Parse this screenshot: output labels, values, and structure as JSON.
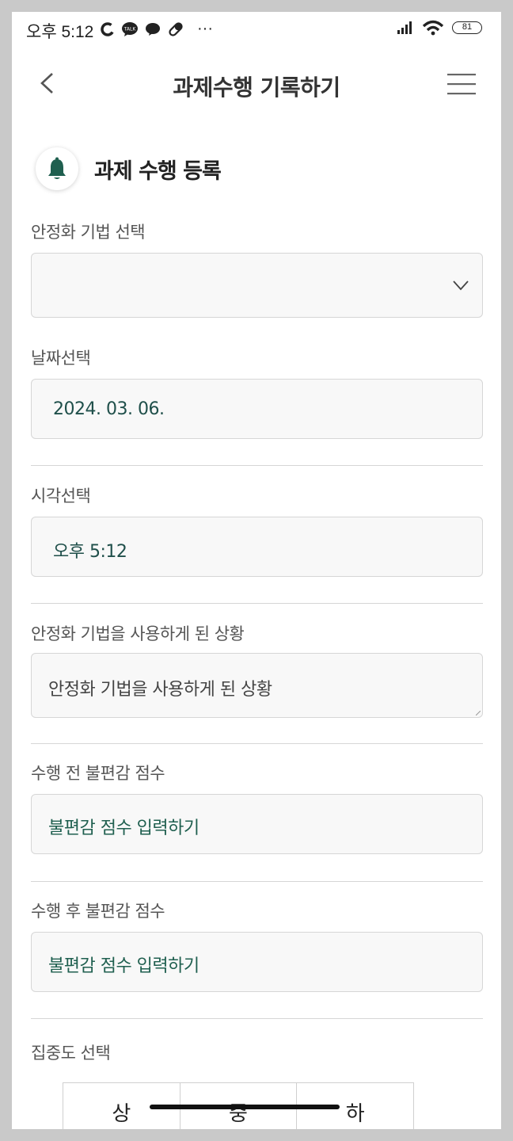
{
  "status_bar": {
    "time": "오후 5:12",
    "battery": "81",
    "more": "···"
  },
  "header": {
    "title": "과제수행 기록하기"
  },
  "section": {
    "title": "과제 수행 등록"
  },
  "form": {
    "technique_label": "안정화 기법 선택",
    "technique_value": "",
    "date_label": "날짜선택",
    "date_value": "2024. 03. 06.",
    "time_label": "시각선택",
    "time_value": "오후 5:12",
    "situation_label": "안정화 기법을 사용하게 된 상황",
    "situation_placeholder": "안정화 기법을 사용하게 된 상황",
    "before_label": "수행 전 불편감 점수",
    "before_placeholder": "불편감 점수 입력하기",
    "after_label": "수행 후 불편감 점수",
    "after_placeholder": "불편감 점수 입력하기",
    "focus_label": "집중도 선택",
    "focus_options": [
      "상",
      "중",
      "하"
    ]
  },
  "colors": {
    "accent": "#1f5f4f",
    "text": "#333333",
    "label": "#555555"
  }
}
